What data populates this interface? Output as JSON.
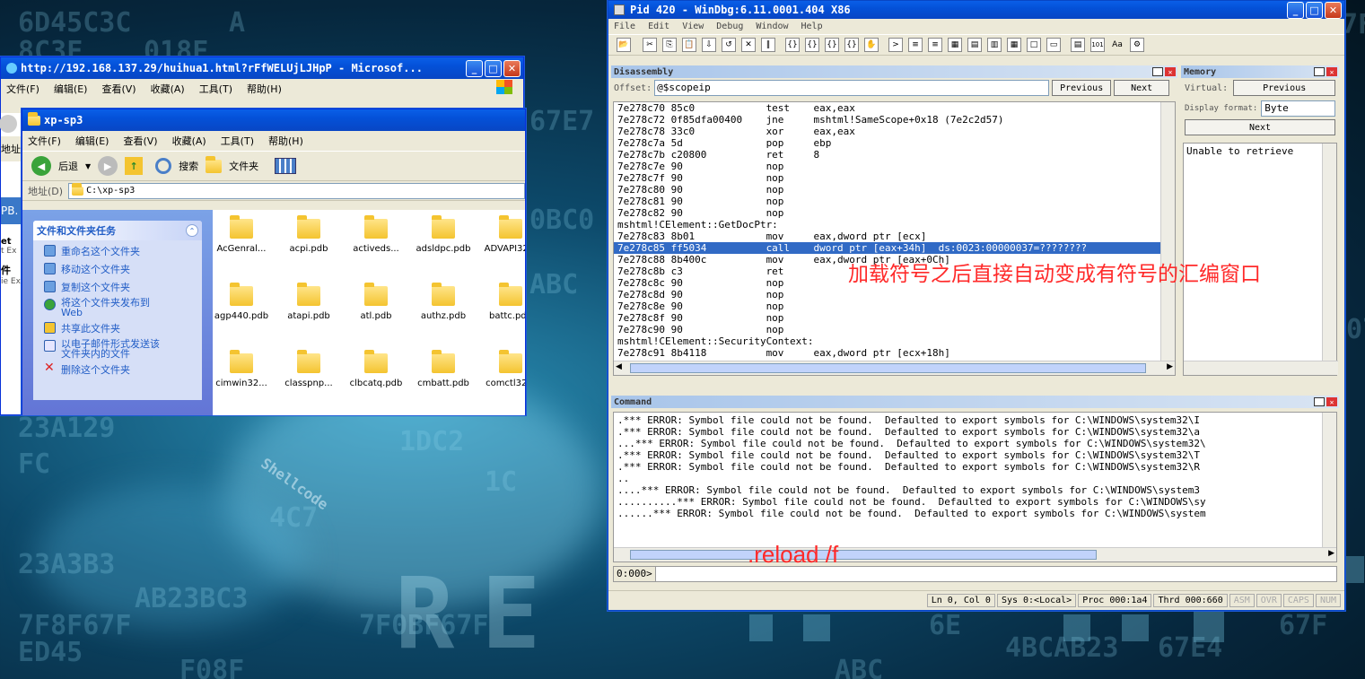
{
  "background": {
    "hex_rows": [
      "6D45C3C",
      "018F",
      "8C3F",
      "A",
      "67E7",
      "0BC0",
      "ABC",
      "23A129",
      "FC",
      "1DC2",
      "4C7",
      "1C",
      "23A3B3",
      "Shellcode",
      "AB23BC3",
      "7F8F67F",
      "ED45",
      "F08F",
      "07",
      "7F",
      "6E",
      "67F",
      "4BCAB23",
      "67E4",
      "ABC",
      "7F0BF67F"
    ],
    "logo_letters": "RE"
  },
  "ie": {
    "title": "http://192.168.137.29/huihua1.html?rFfWELUjLJHpP - Microsof...",
    "menus": [
      "文件(F)",
      "编辑(E)",
      "查看(V)",
      "收藏(A)",
      "工具(T)",
      "帮助(H)"
    ],
    "side_label": "地址",
    "side_text": [
      "PB.",
      "et",
      "t Ex",
      "件",
      "ie Exp"
    ]
  },
  "explorer": {
    "title": "xp-sp3",
    "menus": [
      "文件(F)",
      "编辑(E)",
      "查看(V)",
      "收藏(A)",
      "工具(T)",
      "帮助(H)"
    ],
    "toolbar": {
      "back": "后退",
      "search": "搜索",
      "folders": "文件夹"
    },
    "address_label": "地址(D)",
    "address": "C:\\xp-sp3",
    "task_title": "文件和文件夹任务",
    "tasks": [
      "重命名这个文件夹",
      "移动这个文件夹",
      "复制这个文件夹",
      "将这个文件夹发布到\nWeb",
      "共享此文件夹",
      "以电子邮件形式发送该\n文件夹内的文件",
      "删除这个文件夹"
    ],
    "files": [
      "AcGenral...",
      "acpi.pdb",
      "activeds...",
      "adsldpc.pdb",
      "ADVAPI32...",
      "agp440.pdb",
      "atapi.pdb",
      "atl.pdb",
      "authz.pdb",
      "battc.pdb",
      "cimwin32...",
      "classpnp...",
      "clbcatq.pdb",
      "cmbatt.pdb",
      "comctl32..."
    ]
  },
  "windbg": {
    "title": "Pid 420 - WinDbg:6.11.0001.404 X86",
    "menus": [
      "File",
      "Edit",
      "View",
      "Debug",
      "Window",
      "Help"
    ],
    "disasm": {
      "header": "Disassembly",
      "offset_label": "Offset:",
      "offset": "@$scopeip",
      "prev": "Previous",
      "next": "Next",
      "rows": [
        "7e278c70 85c0            test    eax,eax",
        "7e278c72 0f85dfa00400    jne     mshtml!SameScope+0x18 (7e2c2d57)",
        "7e278c78 33c0            xor     eax,eax",
        "7e278c7a 5d              pop     ebp",
        "7e278c7b c20800          ret     8",
        "7e278c7e 90              nop",
        "7e278c7f 90              nop",
        "7e278c80 90              nop",
        "7e278c81 90              nop",
        "7e278c82 90              nop",
        "mshtml!CElement::GetDocPtr:",
        "7e278c83 8b01            mov     eax,dword ptr [ecx]",
        "7e278c85 ff5034          call    dword ptr [eax+34h]  ds:0023:00000037=????????",
        "7e278c88 8b400c          mov     eax,dword ptr [eax+0Ch]",
        "7e278c8b c3              ret",
        "7e278c8c 90              nop",
        "7e278c8d 90              nop",
        "7e278c8e 90              nop",
        "7e278c8f 90              nop",
        "7e278c90 90              nop",
        "mshtml!CElement::SecurityContext:",
        "7e278c91 8b4118          mov     eax,dword ptr [ecx+18h]",
        "7e278c94 84c0            test    al,al"
      ],
      "selected_index": 12
    },
    "memory": {
      "header": "Memory",
      "virtual_label": "Virtual:",
      "prev": "Previous",
      "format_label": "Display format:",
      "format": "Byte",
      "next": "Next",
      "content": "Unable to retrieve"
    },
    "command": {
      "header": "Command",
      "rows": [
        ".*** ERROR: Symbol file could not be found.  Defaulted to export symbols for C:\\WINDOWS\\system32\\I",
        ".*** ERROR: Symbol file could not be found.  Defaulted to export symbols for C:\\WINDOWS\\system32\\a",
        "...*** ERROR: Symbol file could not be found.  Defaulted to export symbols for C:\\WINDOWS\\system32\\",
        ".*** ERROR: Symbol file could not be found.  Defaulted to export symbols for C:\\WINDOWS\\system32\\T",
        ".*** ERROR: Symbol file could not be found.  Defaulted to export symbols for C:\\WINDOWS\\system32\\R",
        "..",
        "....*** ERROR: Symbol file could not be found.  Defaulted to export symbols for C:\\WINDOWS\\system3",
        "..........*** ERROR: Symbol file could not be found.  Defaulted to export symbols for C:\\WINDOWS\\sy",
        "......*** ERROR: Symbol file could not be found.  Defaulted to export symbols for C:\\WINDOWS\\system"
      ],
      "prompt": "0:000>"
    },
    "status": {
      "pos": "Ln 0, Col 0",
      "sys": "Sys 0:<Local>",
      "proc": "Proc 000:1a4",
      "thrd": "Thrd 000:660",
      "flags": [
        "ASM",
        "OVR",
        "CAPS",
        "NUM"
      ]
    }
  },
  "annotations": {
    "symbol_note": "加载符号之后直接自动变成有符号的汇编窗口",
    "reload": ".reload /f",
    "note_color": "#ff2a2a"
  }
}
